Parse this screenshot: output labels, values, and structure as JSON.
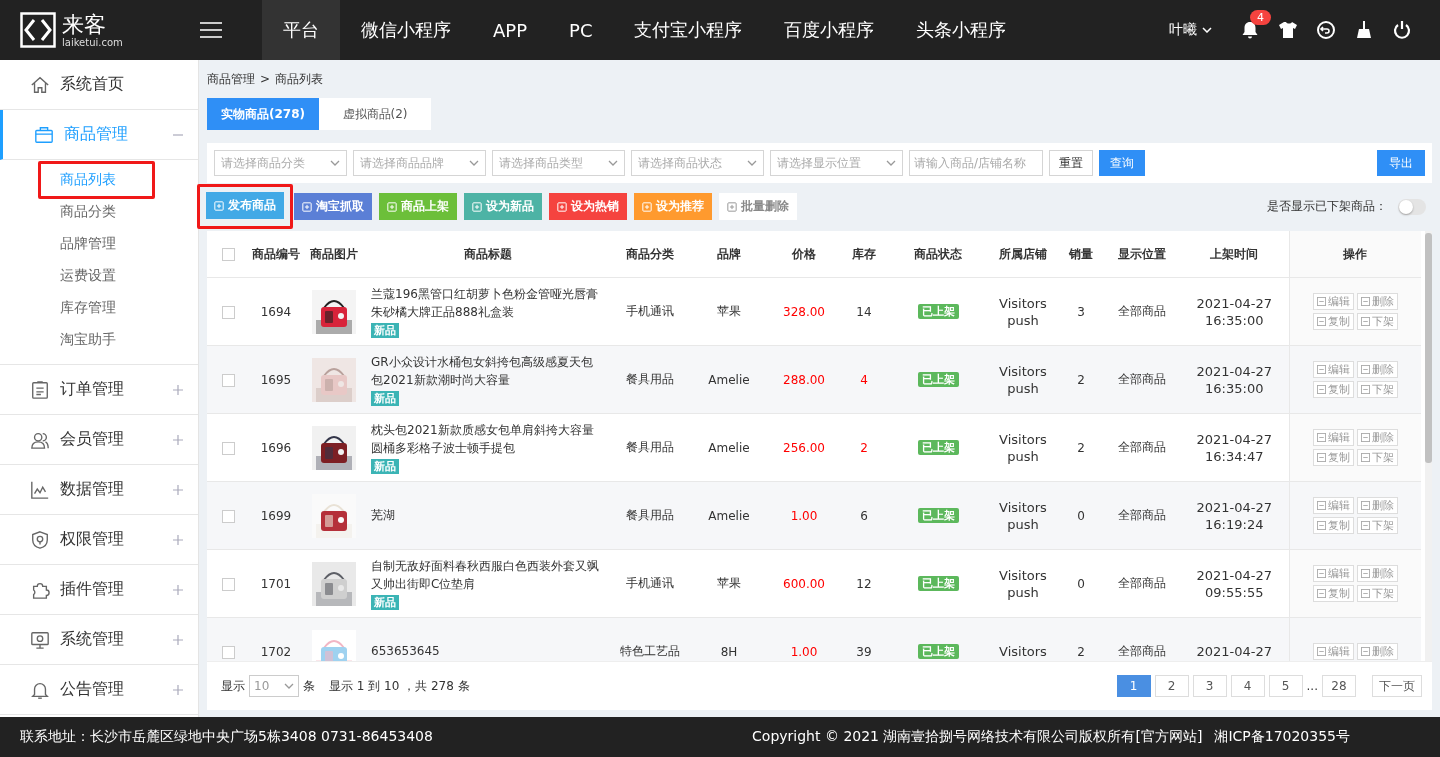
{
  "header": {
    "logo": {
      "name": "来客",
      "domain": "laiketui.com"
    },
    "nav": [
      {
        "label": "平台",
        "selected": true
      },
      {
        "label": "微信小程序",
        "selected": false
      },
      {
        "label": "APP",
        "selected": false
      },
      {
        "label": "PC",
        "selected": false
      },
      {
        "label": "支付宝小程序",
        "selected": false
      },
      {
        "label": "百度小程序",
        "selected": false
      },
      {
        "label": "头条小程序",
        "selected": false
      }
    ],
    "user": "叶曦",
    "notifications": "4"
  },
  "sidebar": {
    "items": [
      {
        "label": "系统首页",
        "selected": false
      },
      {
        "label": "商品管理",
        "selected": true,
        "expanded": true,
        "children": [
          {
            "label": "商品列表",
            "selected": true,
            "highlighted": true
          },
          {
            "label": "商品分类",
            "selected": false,
            "highlighted": false
          },
          {
            "label": "品牌管理",
            "selected": false,
            "highlighted": false
          },
          {
            "label": "运费设置",
            "selected": false,
            "highlighted": false
          },
          {
            "label": "库存管理",
            "selected": false,
            "highlighted": false
          },
          {
            "label": "淘宝助手",
            "selected": false,
            "highlighted": false
          }
        ]
      },
      {
        "label": "订单管理",
        "selected": false,
        "expanded": false
      },
      {
        "label": "会员管理",
        "selected": false,
        "expanded": false
      },
      {
        "label": "数据管理",
        "selected": false,
        "expanded": false
      },
      {
        "label": "权限管理",
        "selected": false,
        "expanded": false
      },
      {
        "label": "插件管理",
        "selected": false,
        "expanded": false
      },
      {
        "label": "系统管理",
        "selected": false,
        "expanded": false
      },
      {
        "label": "公告管理",
        "selected": false,
        "expanded": false
      }
    ]
  },
  "breadcrumb": [
    "商品管理",
    "商品列表"
  ],
  "breadcrumb_separator": ">",
  "tabs": [
    {
      "label": "实物商品(278)",
      "selected": true
    },
    {
      "label": "虚拟商品(2)",
      "selected": false
    }
  ],
  "filters": {
    "selects": [
      {
        "placeholder": "请选择商品分类"
      },
      {
        "placeholder": "请选择商品品牌"
      },
      {
        "placeholder": "请选择商品类型"
      },
      {
        "placeholder": "请选择商品状态"
      },
      {
        "placeholder": "请选择显示位置"
      }
    ],
    "search": {
      "placeholder": "请输入商品/店铺名称"
    },
    "reset": "重置",
    "query": "查询",
    "export": "导出"
  },
  "actions": [
    {
      "label": "发布商品",
      "color": "#42a9e6",
      "highlighted": true
    },
    {
      "label": "淘宝抓取",
      "color": "#5b7fd6",
      "highlighted": false
    },
    {
      "label": "商品上架",
      "color": "#6cbf3a",
      "highlighted": false
    },
    {
      "label": "设为新品",
      "color": "#4db3a5",
      "highlighted": false
    },
    {
      "label": "设为热销",
      "color": "#f5433f",
      "highlighted": false
    },
    {
      "label": "设为推荐",
      "color": "#ff9a2e",
      "highlighted": false
    },
    {
      "label": "批量删除",
      "color": "#ffffff",
      "highlighted": false
    }
  ],
  "show_offline": {
    "label": "是否显示已下架商品：",
    "on": false
  },
  "table": {
    "all_selected": false,
    "columns": [
      "商品编号",
      "商品图片",
      "商品标题",
      "商品分类",
      "品牌",
      "价格",
      "库存",
      "商品状态",
      "所属店铺",
      "销量",
      "显示位置",
      "上架时间",
      "操作"
    ],
    "rows": [
      {
        "selected": false,
        "id": "1694",
        "title": "兰蔻196黑管口红胡萝卜色粉金管哑光唇膏朱砂橘大牌正品888礼盒装",
        "tags": [
          {
            "label": "新品",
            "color": "#3bb4b5"
          }
        ],
        "category": "手机通讯",
        "brand": "苹果",
        "price": "328.00",
        "stock": "14",
        "stock_low": false,
        "status": "已上架",
        "store": [
          "Visitors",
          "push"
        ],
        "sales": "3",
        "position": "全部商品",
        "time": [
          "2021-04-27",
          "16:35:00"
        ],
        "ops": [
          "编辑",
          "删除",
          "复制",
          "下架"
        ]
      },
      {
        "selected": false,
        "id": "1695",
        "title": "GR小众设计水桶包女斜挎包高级感夏天包包2021新款潮时尚大容量",
        "tags": [
          {
            "label": "新品",
            "color": "#3bb4b5"
          }
        ],
        "category": "餐具用品",
        "brand": "Amelie",
        "price": "288.00",
        "stock": "4",
        "stock_low": true,
        "status": "已上架",
        "store": [
          "Visitors",
          "push"
        ],
        "sales": "2",
        "position": "全部商品",
        "time": [
          "2021-04-27",
          "16:35:00"
        ],
        "ops": [
          "编辑",
          "删除",
          "复制",
          "下架"
        ]
      },
      {
        "selected": false,
        "id": "1696",
        "title": "枕头包2021新款质感女包单肩斜挎大容量圆桶多彩格子波士顿手提包",
        "tags": [
          {
            "label": "新品",
            "color": "#3bb4b5"
          }
        ],
        "category": "餐具用品",
        "brand": "Amelie",
        "price": "256.00",
        "stock": "2",
        "stock_low": true,
        "status": "已上架",
        "store": [
          "Visitors",
          "push"
        ],
        "sales": "2",
        "position": "全部商品",
        "time": [
          "2021-04-27",
          "16:34:47"
        ],
        "ops": [
          "编辑",
          "删除",
          "复制",
          "下架"
        ]
      },
      {
        "selected": false,
        "id": "1699",
        "title": "芜湖",
        "tags": [],
        "category": "餐具用品",
        "brand": "Amelie",
        "price": "1.00",
        "stock": "6",
        "stock_low": false,
        "status": "已上架",
        "store": [
          "Visitors",
          "push"
        ],
        "sales": "0",
        "position": "全部商品",
        "time": [
          "2021-04-27",
          "16:19:24"
        ],
        "ops": [
          "编辑",
          "删除",
          "复制",
          "下架"
        ]
      },
      {
        "selected": false,
        "id": "1701",
        "title": "自制无敌好面料春秋西服白色西装外套又飒又帅出街即C位垫肩",
        "tags": [
          {
            "label": "新品",
            "color": "#3bb4b5"
          }
        ],
        "category": "手机通讯",
        "brand": "苹果",
        "price": "600.00",
        "stock": "12",
        "stock_low": false,
        "status": "已上架",
        "store": [
          "Visitors",
          "push"
        ],
        "sales": "0",
        "position": "全部商品",
        "time": [
          "2021-04-27",
          "09:55:55"
        ],
        "ops": [
          "编辑",
          "删除",
          "复制",
          "下架"
        ]
      },
      {
        "selected": false,
        "id": "1702",
        "title": "653653645",
        "tags": [],
        "category": "特色工艺品",
        "brand": "8H",
        "price": "1.00",
        "stock": "39",
        "stock_low": false,
        "status": "已上架",
        "store": [
          "Visitors"
        ],
        "sales": "2",
        "position": "全部商品",
        "time": [
          "2021-04-27"
        ],
        "ops": [
          "编辑",
          "删除"
        ]
      }
    ]
  },
  "pagination": {
    "show_label": "显示",
    "page_size": "10",
    "unit": "条",
    "summary": "显示 1 到 10 ，共 278 条",
    "pages": [
      {
        "label": "1",
        "selected": true
      },
      {
        "label": "2",
        "selected": false
      },
      {
        "label": "3",
        "selected": false
      },
      {
        "label": "4",
        "selected": false
      },
      {
        "label": "5",
        "selected": false
      }
    ],
    "ellipsis": "...",
    "last": "28",
    "next": "下一页"
  },
  "footer": {
    "address": "联系地址：长沙市岳麓区绿地中央广场5栋3408 0731-86453408",
    "copyright": "Copyright © 2021 湖南壹拾捌号网络技术有限公司版权所有[官方网站]",
    "icp": "湘ICP备17020355号"
  }
}
